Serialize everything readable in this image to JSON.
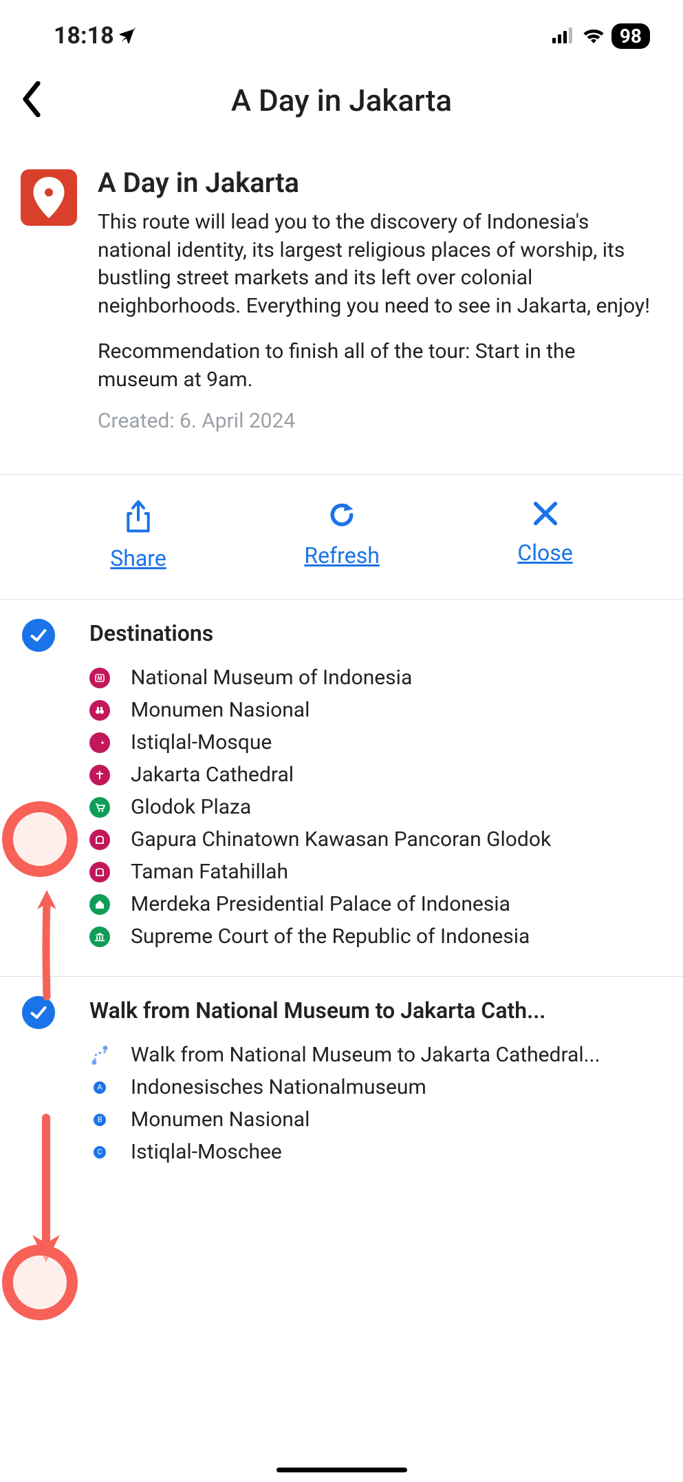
{
  "status": {
    "time": "18:18",
    "battery": "98"
  },
  "header": {
    "title": "A Day in Jakarta"
  },
  "trip": {
    "title": "A Day in Jakarta",
    "description": "This route will lead you to the discovery of Indonesia's national identity, its largest religious places of worship, its bustling street markets and its left over colonial neighborhoods. Everything you need to see in Jakarta, enjoy!",
    "recommendation": "Recommendation to finish all of the tour: Start in the museum at 9am.",
    "created_label": "Created: 6. April 2024"
  },
  "actions": {
    "share": "Share",
    "refresh": "Refresh",
    "close": "Close"
  },
  "sections": {
    "destinations": {
      "title": "Destinations",
      "items": [
        {
          "color": "pink",
          "glyph": "museum",
          "label": "National Museum of Indonesia"
        },
        {
          "color": "pink",
          "glyph": "binoculars",
          "label": "Monumen Nasional"
        },
        {
          "color": "pink",
          "glyph": "crescent",
          "label": "Istiqlal-Mosque"
        },
        {
          "color": "pink",
          "glyph": "cross",
          "label": "Jakarta Cathedral"
        },
        {
          "color": "green",
          "glyph": "cart",
          "label": "Glodok Plaza"
        },
        {
          "color": "pink",
          "glyph": "gate",
          "label": "Gapura Chinatown Kawasan Pancoran Glodok"
        },
        {
          "color": "pink",
          "glyph": "gate",
          "label": "Taman Fatahillah"
        },
        {
          "color": "green",
          "glyph": "house",
          "label": "Merdeka Presidential Palace of Indonesia"
        },
        {
          "color": "green",
          "glyph": "bank",
          "label": "Supreme Court of the Republic of Indonesia"
        }
      ]
    },
    "walk": {
      "title": "Walk from National Museum to Jakarta Cath...",
      "items": [
        {
          "type": "route",
          "label": "Walk from National Museum to Jakarta Cathedral..."
        },
        {
          "type": "dot",
          "letter": "A",
          "label": "Indonesisches Nationalmuseum"
        },
        {
          "type": "dot",
          "letter": "B",
          "label": "Monumen Nasional"
        },
        {
          "type": "dot",
          "letter": "C",
          "label": "Istiqlal-Moschee"
        }
      ]
    }
  }
}
